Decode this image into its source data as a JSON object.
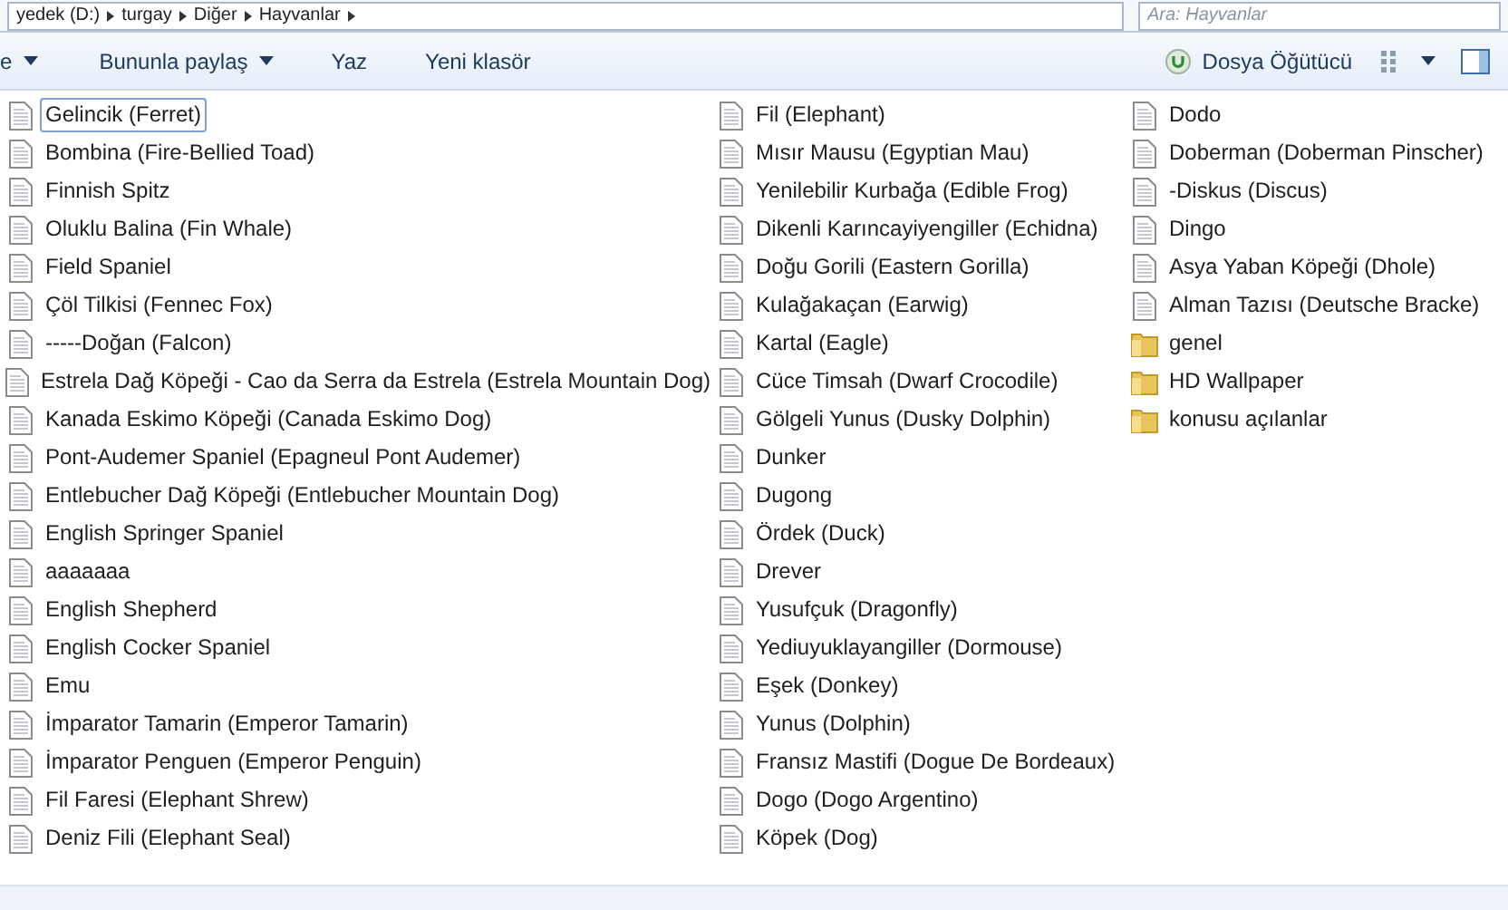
{
  "address_bar": {
    "path": [
      "yedek (D:)",
      "turgay",
      "Diğer",
      "Hayvanlar"
    ],
    "search_placeholder": "Ara: Hayvanlar"
  },
  "toolbar": {
    "left_items": [
      {
        "label": "e",
        "dropdown": true
      },
      {
        "label": "Bununla paylaş",
        "dropdown": true
      },
      {
        "label": "Yaz",
        "dropdown": false
      },
      {
        "label": "Yeni klasör",
        "dropdown": false
      }
    ],
    "helper": "Dosya Öğütücü"
  },
  "items": [
    {
      "kind": "file",
      "name": "Gelincik (Ferret)",
      "selected": true
    },
    {
      "kind": "file",
      "name": "Bombina (Fire-Bellied Toad)",
      "selected": false
    },
    {
      "kind": "file",
      "name": "Finnish Spitz",
      "selected": false
    },
    {
      "kind": "file",
      "name": "Oluklu Balina (Fin Whale)",
      "selected": false
    },
    {
      "kind": "file",
      "name": "Field Spaniel",
      "selected": false
    },
    {
      "kind": "file",
      "name": "Çöl Tilkisi (Fennec Fox)",
      "selected": false
    },
    {
      "kind": "file",
      "name": "-----Doğan (Falcon)",
      "selected": false
    },
    {
      "kind": "file",
      "name": "Estrela Dağ Köpeği - Cao da Serra da Estrela (Estrela Mountain Dog)",
      "selected": false
    },
    {
      "kind": "file",
      "name": "Kanada Eskimo Köpeği (Canada Eskimo Dog)",
      "selected": false
    },
    {
      "kind": "file",
      "name": "Pont-Audemer Spaniel (Epagneul Pont Audemer)",
      "selected": false
    },
    {
      "kind": "file",
      "name": "Entlebucher Dağ Köpeği (Entlebucher Mountain Dog)",
      "selected": false
    },
    {
      "kind": "file",
      "name": "English Springer Spaniel",
      "selected": false
    },
    {
      "kind": "file",
      "name": "aaaaaaa",
      "selected": false
    },
    {
      "kind": "file",
      "name": "English Shepherd",
      "selected": false
    },
    {
      "kind": "file",
      "name": "English Cocker Spaniel",
      "selected": false
    },
    {
      "kind": "file",
      "name": "Emu",
      "selected": false
    },
    {
      "kind": "file",
      "name": "İmparator Tamarin (Emperor Tamarin)",
      "selected": false
    },
    {
      "kind": "file",
      "name": "İmparator Penguen (Emperor Penguin)",
      "selected": false
    },
    {
      "kind": "file",
      "name": "Fil Faresi (Elephant Shrew)",
      "selected": false
    },
    {
      "kind": "file",
      "name": "Deniz Fili (Elephant Seal)",
      "selected": false
    },
    {
      "kind": "file",
      "name": "Fil (Elephant)",
      "selected": false
    },
    {
      "kind": "file",
      "name": "Mısır Mausu (Egyptian Mau)",
      "selected": false
    },
    {
      "kind": "file",
      "name": "Yenilebilir Kurbağa (Edible Frog)",
      "selected": false
    },
    {
      "kind": "file",
      "name": "Dikenli Karıncayiyengiller (Echidna)",
      "selected": false
    },
    {
      "kind": "file",
      "name": "Doğu Gorili (Eastern Gorilla)",
      "selected": false
    },
    {
      "kind": "file",
      "name": "Kulağakaçan (Earwig)",
      "selected": false
    },
    {
      "kind": "file",
      "name": "Kartal (Eagle)",
      "selected": false
    },
    {
      "kind": "file",
      "name": "Cüce Timsah (Dwarf Crocodile)",
      "selected": false
    },
    {
      "kind": "file",
      "name": "Gölgeli Yunus (Dusky Dolphin)",
      "selected": false
    },
    {
      "kind": "file",
      "name": "Dunker",
      "selected": false
    },
    {
      "kind": "file",
      "name": "Dugong",
      "selected": false
    },
    {
      "kind": "file",
      "name": "Ördek (Duck)",
      "selected": false
    },
    {
      "kind": "file",
      "name": "Drever",
      "selected": false
    },
    {
      "kind": "file",
      "name": "Yusufçuk (Dragonfly)",
      "selected": false
    },
    {
      "kind": "file",
      "name": "Yediuyuklayangiller (Dormouse)",
      "selected": false
    },
    {
      "kind": "file",
      "name": "Eşek (Donkey)",
      "selected": false
    },
    {
      "kind": "file",
      "name": "Yunus (Dolphin)",
      "selected": false
    },
    {
      "kind": "file",
      "name": "Fransız Mastifi (Dogue De Bordeaux)",
      "selected": false
    },
    {
      "kind": "file",
      "name": "Dogo (Dogo Argentino)",
      "selected": false
    },
    {
      "kind": "file",
      "name": "Köpek (Dog)",
      "selected": false
    },
    {
      "kind": "file",
      "name": "Dodo",
      "selected": false
    },
    {
      "kind": "file",
      "name": "Doberman (Doberman Pinscher)",
      "selected": false
    },
    {
      "kind": "file",
      "name": "-Diskus (Discus)",
      "selected": false
    },
    {
      "kind": "file",
      "name": "Dingo",
      "selected": false
    },
    {
      "kind": "file",
      "name": "Asya Yaban Köpeği (Dhole)",
      "selected": false
    },
    {
      "kind": "file",
      "name": "Alman Tazısı (Deutsche Bracke)",
      "selected": false
    },
    {
      "kind": "folder",
      "name": "genel",
      "selected": false
    },
    {
      "kind": "folder",
      "name": "HD Wallpaper",
      "selected": false
    },
    {
      "kind": "folder",
      "name": "konusu açılanlar",
      "selected": false
    }
  ]
}
